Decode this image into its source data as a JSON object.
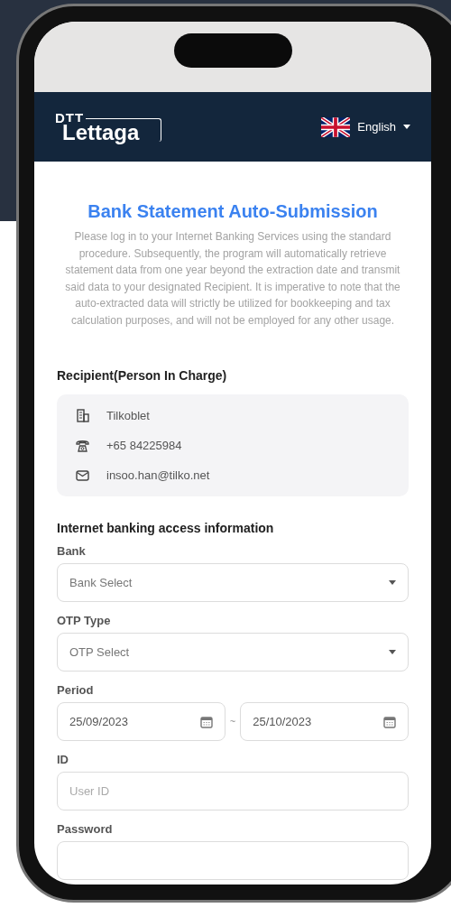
{
  "header": {
    "logo": {
      "top": "DTT",
      "bottom": "Lettaga"
    },
    "language": "English"
  },
  "title": "Bank Statement Auto-Submission",
  "description": "Please log in to your Internet Banking Services using the standard procedure. Subsequently, the program will automatically retrieve statement data from one year beyond the extraction date and transmit said data to your designated Recipient. It is imperative to note that the auto-extracted data will strictly be utilized for bookkeeping and tax calculation purposes, and will not be employed for any other usage.",
  "recipient": {
    "heading": "Recipient(Person In Charge)",
    "items": [
      {
        "kind": "company",
        "text": "Tilkoblet"
      },
      {
        "kind": "phone",
        "text": "+65 84225984"
      },
      {
        "kind": "email",
        "text": "insoo.han@tilko.net"
      }
    ]
  },
  "access": {
    "heading": "Internet banking access information",
    "fields": [
      {
        "kind": "select",
        "label": "Bank",
        "placeholder": "Bank Select"
      },
      {
        "kind": "select",
        "label": "OTP Type",
        "placeholder": "OTP Select"
      },
      {
        "kind": "daterange",
        "label": "Period",
        "from": "25/09/2023",
        "separator": "~",
        "to": "25/10/2023"
      },
      {
        "kind": "text",
        "label": "ID",
        "placeholder": "User ID"
      },
      {
        "kind": "text",
        "label": "Password"
      }
    ]
  }
}
